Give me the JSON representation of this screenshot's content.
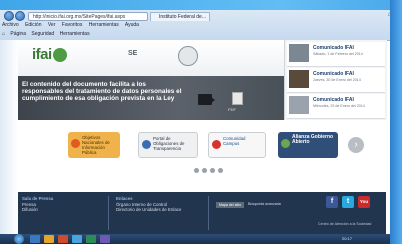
{
  "browser": {
    "address": "http://inicio.ifai.org.mx/SitePages/ifai.aspx",
    "tab_label": "Instituto Federal de...",
    "menu": [
      "Archivo",
      "Edición",
      "Ver",
      "Favoritos",
      "Herramientas",
      "Ayuda"
    ],
    "commands": [
      "Página",
      "Seguridad",
      "Herramientas"
    ]
  },
  "header": {
    "logo_text": "ifai",
    "se_text": "SE"
  },
  "hero": {
    "headline": "El contenido del documento facilita a los responsables del tratamiento de datos personales el cumplimiento de esa obligación prevista en la Ley",
    "pdf_label": "PDF"
  },
  "comunicados": [
    {
      "title": "Comunicado IFAI",
      "date": "Sábado, 1 de Febrero del 2014"
    },
    {
      "title": "Comunicado IFAI",
      "date": "Jueves, 30 de Enero del 2014"
    },
    {
      "title": "Comunicado IFAI",
      "date": "Miércoles, 29 de Enero del 2014"
    }
  ],
  "partners": [
    {
      "label": "Objetivos Nacionales de Información Pública"
    },
    {
      "label": "Portal de Obligaciones de Transparencia"
    },
    {
      "label": "Comunidad Campus"
    },
    {
      "label": "Alianza Gobierno Abierto"
    }
  ],
  "footer": {
    "col1_head": "Sala de Prensa",
    "col1_items": [
      "Prensa",
      "Difusión"
    ],
    "col2_head": "Enlaces",
    "col2_items": [
      "Órgano Interno de Control",
      "Directorio de Unidades de Enlace"
    ],
    "sitemap_button": "Mapa del sitio",
    "sitemap_text": "Búsqueda avanzada",
    "note": "Centro de Atención a la Sociedad"
  },
  "social": {
    "facebook": "f",
    "twitter": "t",
    "youtube": "You"
  },
  "taskbar": {
    "time": "20:17"
  }
}
